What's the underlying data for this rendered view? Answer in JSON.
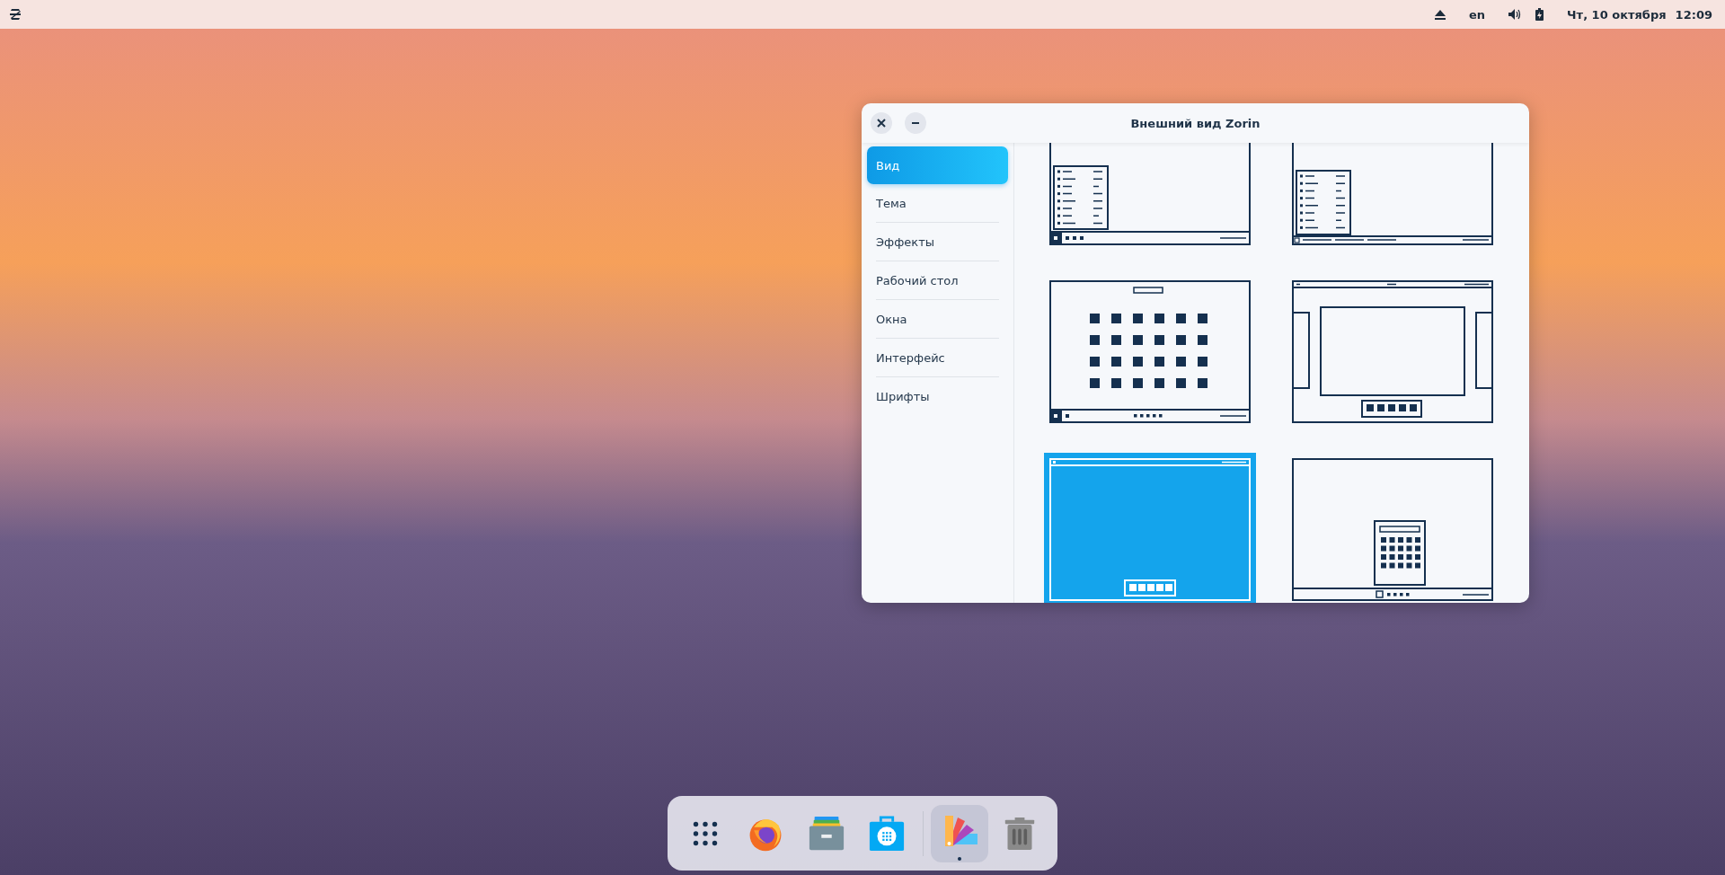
{
  "top_bar": {
    "language": "en",
    "date": "Чт, 10 октября",
    "time": "12:09"
  },
  "window": {
    "title": "Внешний вид Zorin",
    "sidebar": {
      "items": [
        {
          "label": "Вид",
          "selected": true
        },
        {
          "label": "Тема",
          "selected": false
        },
        {
          "label": "Эффекты",
          "selected": false
        },
        {
          "label": "Рабочий стол",
          "selected": false
        },
        {
          "label": "Окна",
          "selected": false
        },
        {
          "label": "Интерфейс",
          "selected": false
        },
        {
          "label": "Шрифты",
          "selected": false
        }
      ]
    },
    "layouts": [
      {
        "kind": "start-menu",
        "selected": false
      },
      {
        "kind": "start-menu-tasklist",
        "selected": false
      },
      {
        "kind": "app-grid",
        "selected": false
      },
      {
        "kind": "top-bar-dock",
        "selected": false
      },
      {
        "kind": "fullscreen-dock",
        "selected": true
      },
      {
        "kind": "centered-menu",
        "selected": false
      }
    ]
  },
  "dock": {
    "items": [
      {
        "kind": "apps",
        "running": false
      },
      {
        "kind": "browser",
        "running": false
      },
      {
        "kind": "files",
        "running": false
      },
      {
        "kind": "store",
        "running": false
      },
      {
        "kind": "palette",
        "running": true
      },
      {
        "kind": "trash",
        "running": false
      }
    ]
  }
}
